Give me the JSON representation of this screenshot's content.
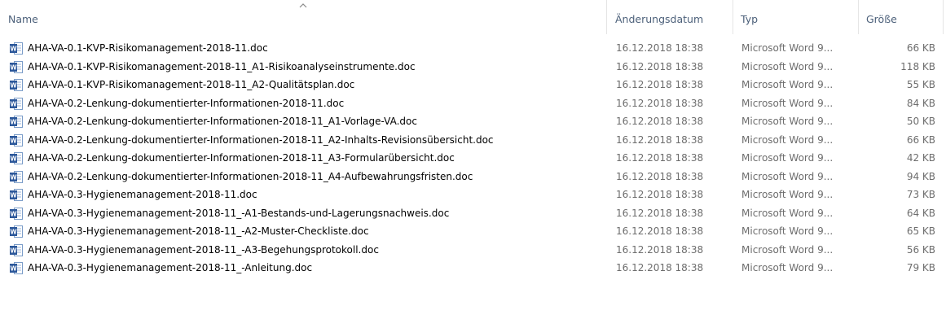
{
  "columns": {
    "name": "Name",
    "date": "Änderungsdatum",
    "type": "Typ",
    "size": "Größe"
  },
  "colors": {
    "word_blue": "#2b579a",
    "header_text": "#4c607a",
    "meta_text": "#6d6d6d"
  },
  "icons": {
    "file": "word-document-icon",
    "sort": "sort-ascending-icon"
  },
  "files": [
    {
      "name": "AHA-VA-0.1-KVP-Risikomanagement-2018-11.doc",
      "date": "16.12.2018 18:38",
      "type": "Microsoft Word 9...",
      "size": "66 KB"
    },
    {
      "name": "AHA-VA-0.1-KVP-Risikomanagement-2018-11_A1-Risikoanalyseinstrumente.doc",
      "date": "16.12.2018 18:38",
      "type": "Microsoft Word 9...",
      "size": "118 KB"
    },
    {
      "name": "AHA-VA-0.1-KVP-Risikomanagement-2018-11_A2-Qualitätsplan.doc",
      "date": "16.12.2018 18:38",
      "type": "Microsoft Word 9...",
      "size": "55 KB"
    },
    {
      "name": "AHA-VA-0.2-Lenkung-dokumentierter-Informationen-2018-11.doc",
      "date": "16.12.2018 18:38",
      "type": "Microsoft Word 9...",
      "size": "84 KB"
    },
    {
      "name": "AHA-VA-0.2-Lenkung-dokumentierter-Informationen-2018-11_A1-Vorlage-VA.doc",
      "date": "16.12.2018 18:38",
      "type": "Microsoft Word 9...",
      "size": "50 KB"
    },
    {
      "name": "AHA-VA-0.2-Lenkung-dokumentierter-Informationen-2018-11_A2-Inhalts-Revisionsübersicht.doc",
      "date": "16.12.2018 18:38",
      "type": "Microsoft Word 9...",
      "size": "66 KB"
    },
    {
      "name": "AHA-VA-0.2-Lenkung-dokumentierter-Informationen-2018-11_A3-Formularübersicht.doc",
      "date": "16.12.2018 18:38",
      "type": "Microsoft Word 9...",
      "size": "42 KB"
    },
    {
      "name": "AHA-VA-0.2-Lenkung-dokumentierter-Informationen-2018-11_A4-Aufbewahrungsfristen.doc",
      "date": "16.12.2018 18:38",
      "type": "Microsoft Word 9...",
      "size": "94 KB"
    },
    {
      "name": "AHA-VA-0.3-Hygienemanagement-2018-11.doc",
      "date": "16.12.2018 18:38",
      "type": "Microsoft Word 9...",
      "size": "73 KB"
    },
    {
      "name": "AHA-VA-0.3-Hygienemanagement-2018-11_-A1-Bestands-und-Lagerungsnachweis.doc",
      "date": "16.12.2018 18:38",
      "type": "Microsoft Word 9...",
      "size": "64 KB"
    },
    {
      "name": "AHA-VA-0.3-Hygienemanagement-2018-11_-A2-Muster-Checkliste.doc",
      "date": "16.12.2018 18:38",
      "type": "Microsoft Word 9...",
      "size": "65 KB"
    },
    {
      "name": "AHA-VA-0.3-Hygienemanagement-2018-11_-A3-Begehungsprotokoll.doc",
      "date": "16.12.2018 18:38",
      "type": "Microsoft Word 9...",
      "size": "56 KB"
    },
    {
      "name": "AHA-VA-0.3-Hygienemanagement-2018-11_-Anleitung.doc",
      "date": "16.12.2018 18:38",
      "type": "Microsoft Word 9...",
      "size": "79 KB"
    }
  ]
}
